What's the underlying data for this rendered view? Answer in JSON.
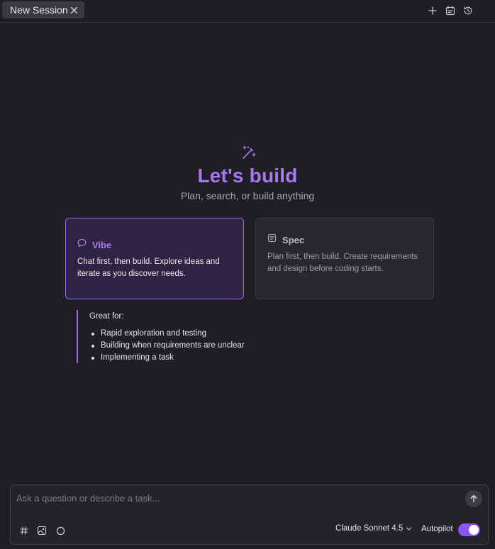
{
  "tab": {
    "label": "New Session"
  },
  "toolbar": {
    "icons": [
      "plus-icon",
      "calendar-list-icon",
      "history-icon"
    ]
  },
  "hero": {
    "icon": "magic-wand-icon",
    "title": "Let's build",
    "subtitle": "Plan, search, or build anything"
  },
  "modes": [
    {
      "title": "Vibe",
      "icon": "chat-bubble-icon",
      "description": "Chat first, then build. Explore ideas and iterate as you discover needs.",
      "selected": true
    },
    {
      "title": "Spec",
      "icon": "document-icon",
      "description": "Plan first, then build. Create requirements and design before coding starts.",
      "selected": false
    }
  ],
  "great_for": {
    "label": "Great for:",
    "items": [
      "Rapid exploration and testing",
      "Building when requirements are unclear",
      "Implementing a task"
    ]
  },
  "composer": {
    "placeholder": "Ask a question or describe a task...",
    "value": "",
    "icons": [
      "hash-icon",
      "image-icon",
      "circle-icon",
      "send-arrow-icon"
    ],
    "model": "Claude Sonnet 4.5",
    "autopilot_label": "Autopilot",
    "autopilot_on": true
  },
  "colors": {
    "background": "#1f1e24",
    "accent": "#a978f0",
    "toggle": "#8a55f0"
  }
}
